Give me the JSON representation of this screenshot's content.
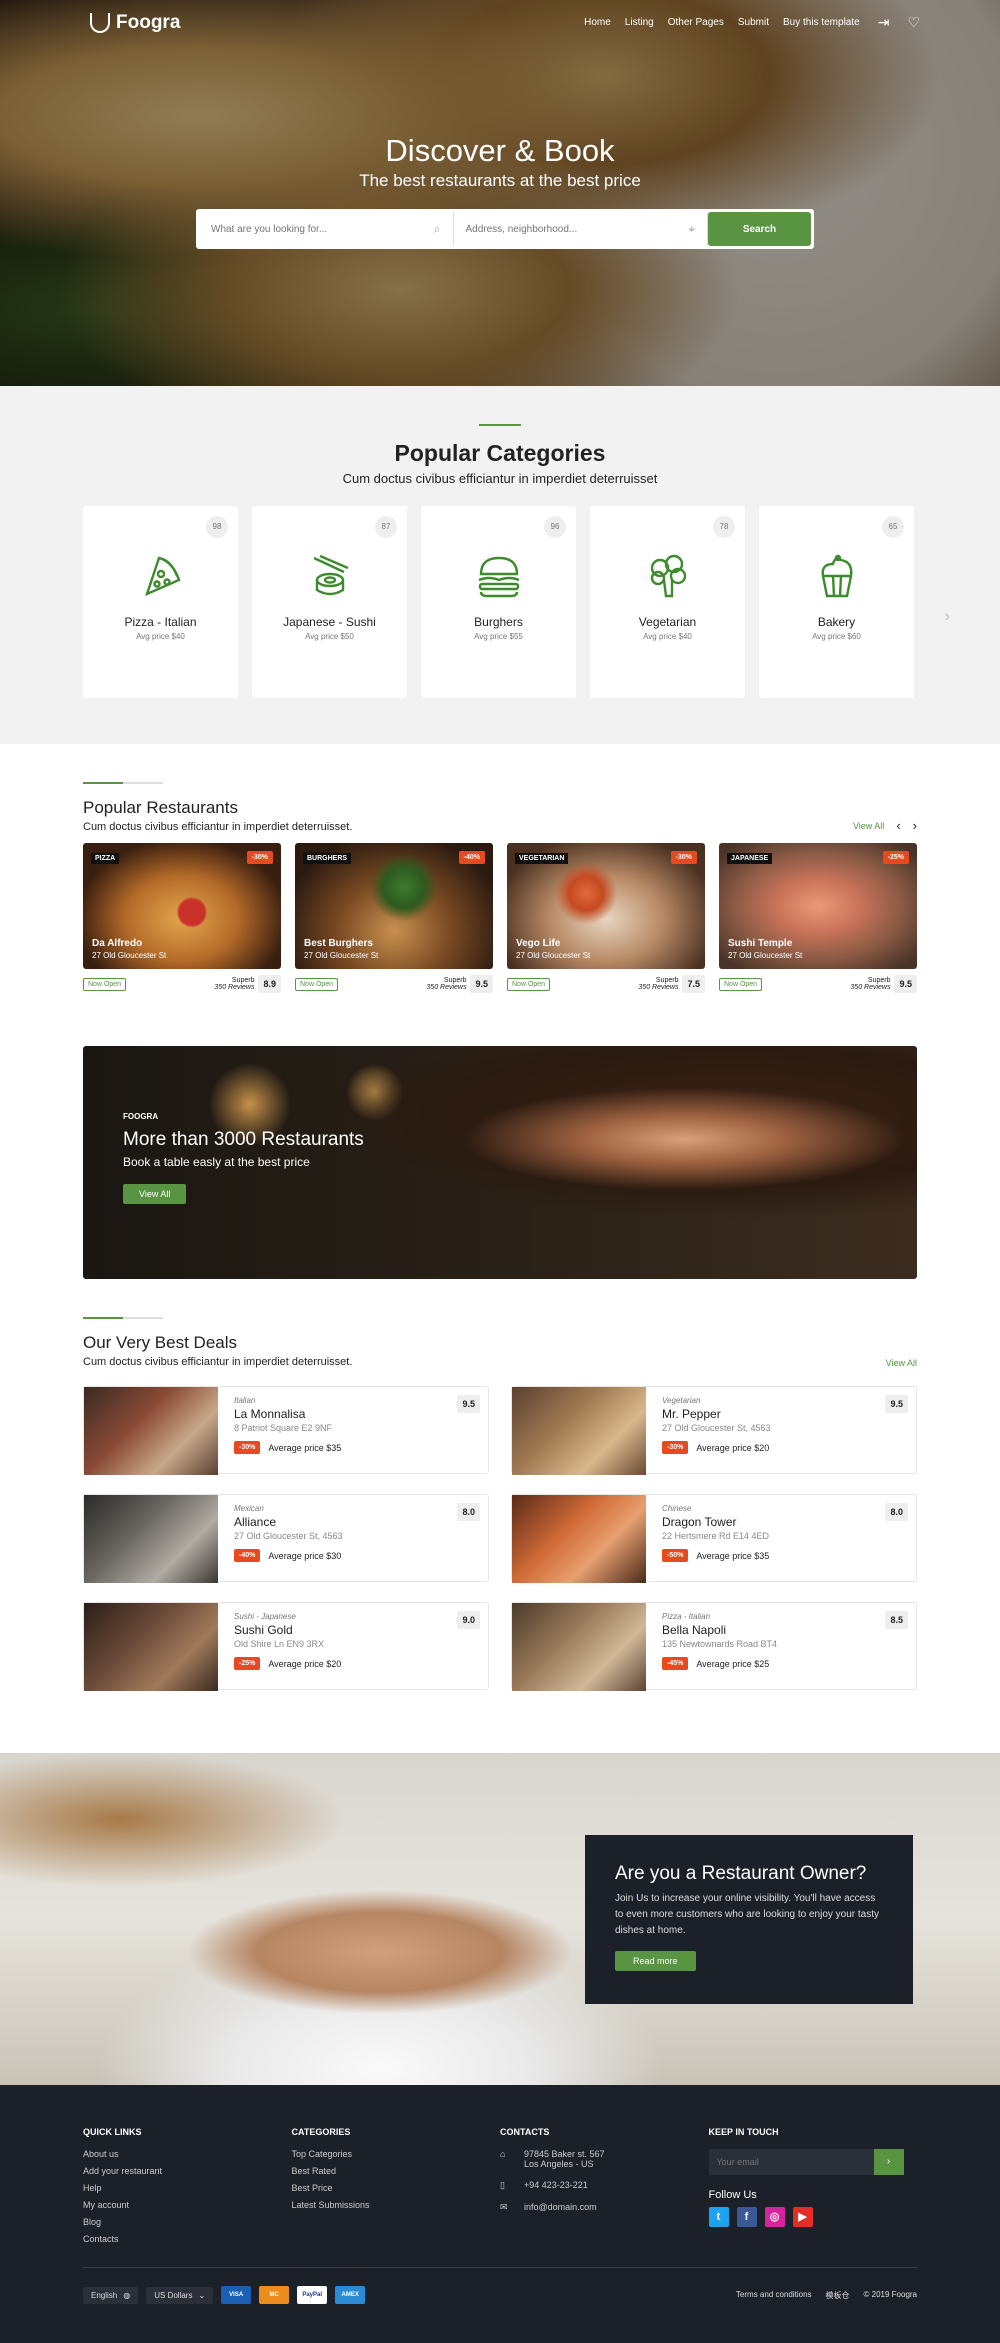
{
  "nav": {
    "brand": "Foogra",
    "links": [
      "Home",
      "Listing",
      "Other Pages",
      "Submit",
      "Buy this template"
    ]
  },
  "hero": {
    "title": "Discover & Book",
    "subtitle": "The best restaurants at the best price",
    "search_placeholder": "What are you looking for...",
    "address_placeholder": "Address, neighborhood...",
    "search_button": "Search"
  },
  "categories": {
    "title": "Popular Categories",
    "subtitle": "Cum doctus civibus efficiantur in imperdiet deterruisset",
    "items": [
      {
        "name": "Pizza - Italian",
        "price": "Avg price $40",
        "count": "98",
        "icon": "pizza-icon"
      },
      {
        "name": "Japanese - Sushi",
        "price": "Avg price $50",
        "count": "87",
        "icon": "sushi-icon"
      },
      {
        "name": "Burghers",
        "price": "Avg price $55",
        "count": "96",
        "icon": "burger-icon"
      },
      {
        "name": "Vegetarian",
        "price": "Avg price $40",
        "count": "78",
        "icon": "broccoli-icon"
      },
      {
        "name": "Bakery",
        "price": "Avg price $60",
        "count": "65",
        "icon": "cupcake-icon"
      }
    ]
  },
  "popular": {
    "title": "Popular Restaurants",
    "subtitle": "Cum doctus civibus efficiantur in imperdiet deterruisset.",
    "view_all": "View All",
    "items": [
      {
        "tag": "PIZZA",
        "discount": "-30%",
        "name": "Da Alfredo",
        "address": "27 Old Gloucester St",
        "status": "Now Open",
        "rating_word": "Superb",
        "reviews": "350 Reviews",
        "score": "8.9",
        "bg": "#8a4a22"
      },
      {
        "tag": "BURGHERS",
        "discount": "-40%",
        "name": "Best Burghers",
        "address": "27 Old Gloucester St",
        "status": "Now Open",
        "rating_word": "Superb",
        "reviews": "350 Reviews",
        "score": "9.5",
        "bg": "#5d4a2a"
      },
      {
        "tag": "VEGETARIAN",
        "discount": "-30%",
        "name": "Vego Life",
        "address": "27 Old Gloucester St",
        "status": "Now Open",
        "rating_word": "Superb",
        "reviews": "350 Reviews",
        "score": "7.5",
        "bg": "#b0684a"
      },
      {
        "tag": "JAPANESE",
        "discount": "-25%",
        "name": "Sushi Temple",
        "address": "27 Old Gloucester St",
        "status": "Now Open",
        "rating_word": "Superb",
        "reviews": "350 Reviews",
        "score": "9.5",
        "bg": "#a07a62"
      }
    ]
  },
  "banner": {
    "small": "FOOGRA",
    "title": "More than 3000 Restaurants",
    "subtitle": "Book a table easly at the best price",
    "button": "View All"
  },
  "deals": {
    "title": "Our Very Best Deals",
    "subtitle": "Cum doctus civibus efficiantur in imperdiet deterruisset.",
    "view_all": "View All",
    "items": [
      {
        "cuisine": "Italian",
        "name": "La Monnalisa",
        "address": "8 Patriot Square E2 9NF",
        "discount": "-30%",
        "price": "Average price $35",
        "score": "9.5",
        "bg": "#7a4a36"
      },
      {
        "cuisine": "Vegetarian",
        "name": "Mr. Pepper",
        "address": "27 Old Gloucester St, 4563",
        "discount": "-30%",
        "price": "Average price $20",
        "score": "9.5",
        "bg": "#8a6a48"
      },
      {
        "cuisine": "Mexican",
        "name": "Alliance",
        "address": "27 Old Gloucester St, 4563",
        "discount": "-40%",
        "price": "Average price $30",
        "score": "8.0",
        "bg": "#4a4640"
      },
      {
        "cuisine": "Chinese",
        "name": "Dragon Tower",
        "address": "22 Hertsmere Rd E14 4ED",
        "discount": "-50%",
        "price": "Average price $35",
        "score": "8.0",
        "bg": "#9a5a36"
      },
      {
        "cuisine": "Sushi - Japanese",
        "name": "Sushi Gold",
        "address": "Old Shire Ln EN9 3RX",
        "discount": "-25%",
        "price": "Average price $20",
        "score": "9.0",
        "bg": "#5a4034"
      },
      {
        "cuisine": "Pizza - Italian",
        "name": "Bella Napoli",
        "address": "135 Newtownards Road BT4",
        "discount": "-45%",
        "price": "Average price $25",
        "score": "8.5",
        "bg": "#8a6a4a"
      }
    ]
  },
  "owner": {
    "title": "Are you a Restaurant Owner?",
    "text": "Join Us to increase your online visibility. You'll have access to even more customers who are looking to enjoy your tasty dishes at home.",
    "button": "Read more"
  },
  "footer": {
    "quick_title": "QUICK LINKS",
    "quick": [
      "About us",
      "Add your restaurant",
      "Help",
      "My account",
      "Blog",
      "Contacts"
    ],
    "cat_title": "CATEGORIES",
    "cats": [
      "Top Categories",
      "Best Rated",
      "Best Price",
      "Latest Submissions"
    ],
    "contacts_title": "CONTACTS",
    "address1": "97845 Baker st. 567",
    "address2": "Los Angeles - US",
    "phone": "+94 423-23-221",
    "email": "info@domain.com",
    "keep_title": "KEEP IN TOUCH",
    "email_placeholder": "Your email",
    "follow": "Follow Us",
    "language": "English",
    "currency": "US Dollars",
    "cards": [
      "VISA",
      "MC",
      "PayPal",
      "AMEX"
    ],
    "terms": "Terms and conditions",
    "site": "模板仓",
    "copyright": "© 2019 Foogra"
  },
  "colors": {
    "accent": "#589442",
    "discount": "#e64b1f",
    "dark": "#1c2029"
  }
}
